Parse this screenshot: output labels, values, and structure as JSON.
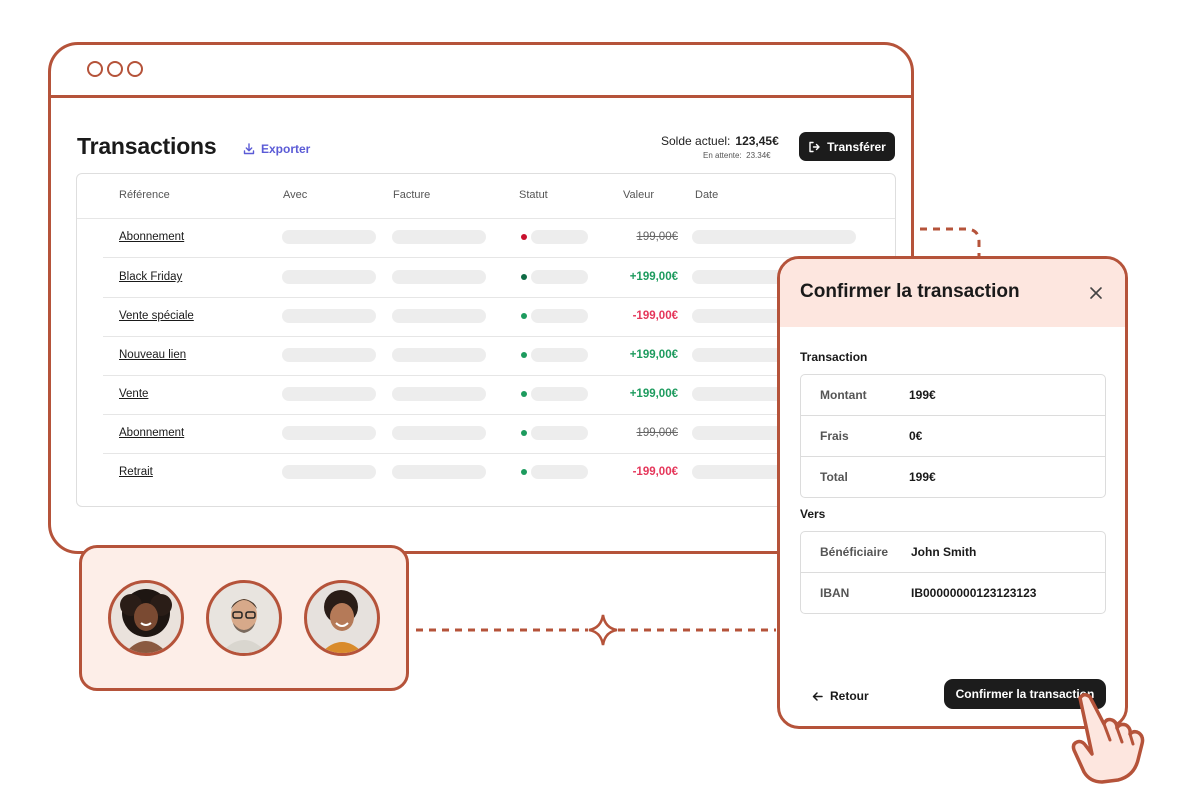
{
  "page": {
    "title": "Transactions",
    "export_label": "Exporter",
    "balance_label": "Solde actuel:",
    "balance_value": "123,45€",
    "pending_label": "En attente:",
    "pending_value": "23.34€",
    "transfer_label": "Transférer"
  },
  "table": {
    "headers": [
      "Référence",
      "Avec",
      "Facture",
      "Statut",
      "Valeur",
      "Date"
    ],
    "rows": [
      {
        "reference": "Abonnement",
        "status": "failed",
        "value": "199,00€",
        "value_style": "struck"
      },
      {
        "reference": "Black Friday",
        "status": "pending",
        "value": "+199,00€",
        "value_style": "positive"
      },
      {
        "reference": "Vente spéciale",
        "status": "success",
        "value": "-199,00€",
        "value_style": "negative"
      },
      {
        "reference": "Nouveau lien",
        "status": "success",
        "value": "+199,00€",
        "value_style": "positive"
      },
      {
        "reference": "Vente",
        "status": "success",
        "value": "+199,00€",
        "value_style": "positive"
      },
      {
        "reference": "Abonnement",
        "status": "success",
        "value": "199,00€",
        "value_style": "struck"
      },
      {
        "reference": "Retrait",
        "status": "success",
        "value": "-199,00€",
        "value_style": "negative"
      }
    ]
  },
  "modal": {
    "title": "Confirmer la transaction",
    "transaction_label": "Transaction",
    "transaction_rows": [
      {
        "key": "Montant",
        "value": "199€"
      },
      {
        "key": "Frais",
        "value": "0€"
      },
      {
        "key": "Total",
        "value": "199€"
      }
    ],
    "to_label": "Vers",
    "to_rows": [
      {
        "key": "Bénéficiaire",
        "value": "John Smith"
      },
      {
        "key": "IBAN",
        "value": "IB00000000123123123"
      }
    ],
    "back_label": "Retour",
    "confirm_label": "Confirmer la transaction"
  },
  "icons": {
    "export": "download-icon",
    "transfer": "logout-arrow-icon",
    "close": "close-icon",
    "back": "arrow-left-icon",
    "pointer": "hand-pointer-icon"
  },
  "colors": {
    "brand": "#b5533a",
    "modal_header": "#fde6df",
    "card_bg": "#fdeee8",
    "positive": "#1d9b5e",
    "negative": "#e5365a",
    "failed_dot": "#c8102e",
    "pending_dot": "#0f6b45",
    "success_dot": "#1d9b5e",
    "link": "#5b5bd6"
  }
}
